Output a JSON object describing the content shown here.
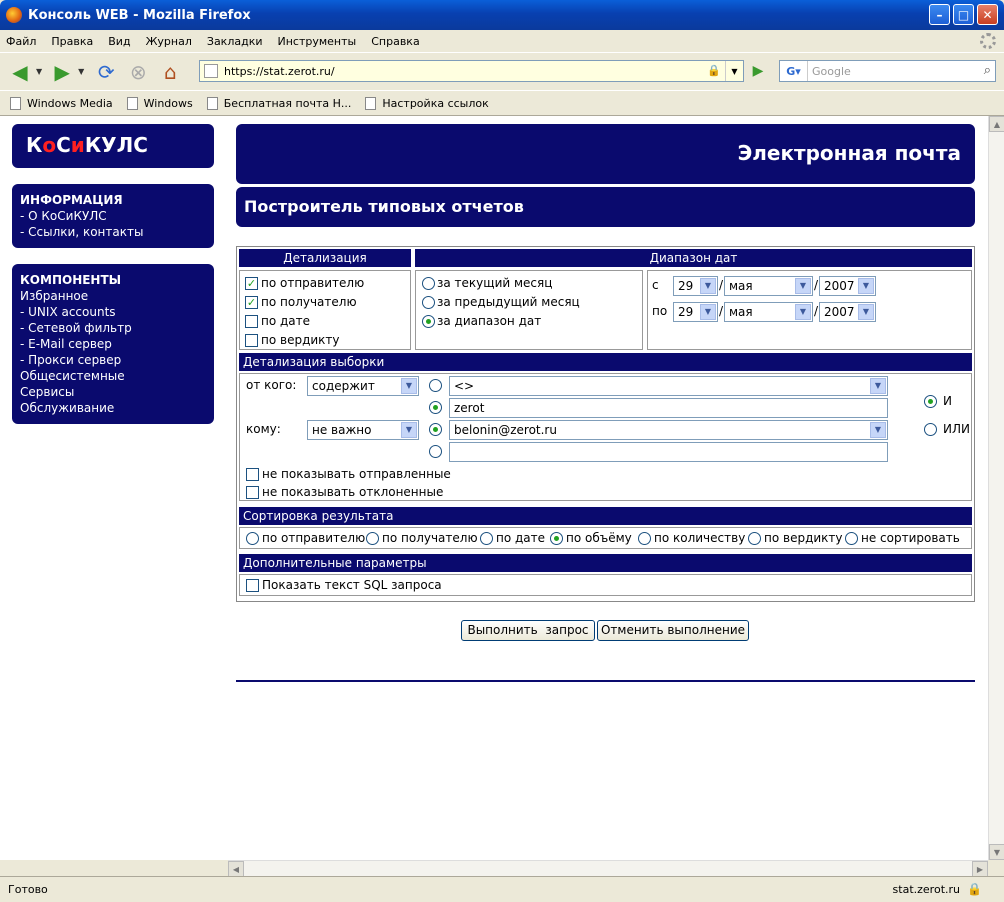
{
  "window": {
    "title": "Консоль WEB - Mozilla Firefox"
  },
  "menu": [
    "Файл",
    "Правка",
    "Вид",
    "Журнал",
    "Закладки",
    "Инструменты",
    "Справка"
  ],
  "nav": {
    "url": "https://stat.zerot.ru/",
    "search_placeholder": "Google"
  },
  "bookmarks": [
    "Windows Media",
    "Windows",
    "Бесплатная почта Н...",
    "Настройка ссылок"
  ],
  "sidebar": {
    "logo": {
      "a": "К",
      "b": "о",
      "c": "С",
      "d": "и",
      "e": "КУЛС"
    },
    "info_title": "ИНФОРМАЦИЯ",
    "info_items": [
      " - О КоСиКУЛС",
      " - Ссылки, контакты"
    ],
    "comp_title": "КОМПОНЕНТЫ",
    "comp_items": [
      "Избранное",
      " - UNIX accounts",
      " - Сетевой фильтр",
      " - E-Mail сервер",
      " - Прокси сервер",
      "Общесистемные",
      "Сервисы",
      "Обслуживание"
    ]
  },
  "header": {
    "main": "Электронная почта",
    "sub": "Построитель типовых отчетов"
  },
  "form": {
    "detail_title": "Детализация",
    "date_range_title": "Диапазон дат",
    "detail_options": [
      {
        "label": "по отправителю",
        "checked": true
      },
      {
        "label": "по получателю",
        "checked": true
      },
      {
        "label": "по дате",
        "checked": false
      },
      {
        "label": "по вердикту",
        "checked": false
      }
    ],
    "range_options": [
      {
        "label": "за текущий месяц",
        "selected": false
      },
      {
        "label": "за предыдущий месяц",
        "selected": false
      },
      {
        "label": "за диапазон дат",
        "selected": true
      }
    ],
    "from_label": "с",
    "to_label": "по",
    "date_sep": "/",
    "from_date": {
      "day": "29",
      "month": "мая",
      "year": "2007"
    },
    "to_date": {
      "day": "29",
      "month": "мая",
      "year": "2007"
    },
    "selection_title": "Детализация выборки",
    "from_who_label": "от кого:",
    "to_who_label": "кому:",
    "from_condition": "содержит",
    "to_condition": "не важно",
    "from_list_value": "<>",
    "from_text_value": "zerot",
    "to_list_value": "belonin@zerot.ru",
    "to_text_value": "",
    "and_label": "И",
    "or_label": "ИЛИ",
    "hide_sent": "не показывать отправленные",
    "hide_rejected": "не показывать отклоненные",
    "sort_title": "Сортировка результата",
    "sort_options": [
      {
        "label": "по отправителю",
        "selected": false
      },
      {
        "label": "по получателю",
        "selected": false
      },
      {
        "label": "по дате",
        "selected": false
      },
      {
        "label": "по объёму",
        "selected": true
      },
      {
        "label": "по количеству",
        "selected": false
      },
      {
        "label": "по вердикту",
        "selected": false
      },
      {
        "label": "не сортировать",
        "selected": false
      }
    ],
    "extra_title": "Дополнительные параметры",
    "show_sql": "Показать текст SQL запроса",
    "run_button": "Выполнить  запрос",
    "cancel_button": "Отменить выполнение"
  },
  "status": {
    "text": "Готово",
    "host": "stat.zerot.ru"
  }
}
